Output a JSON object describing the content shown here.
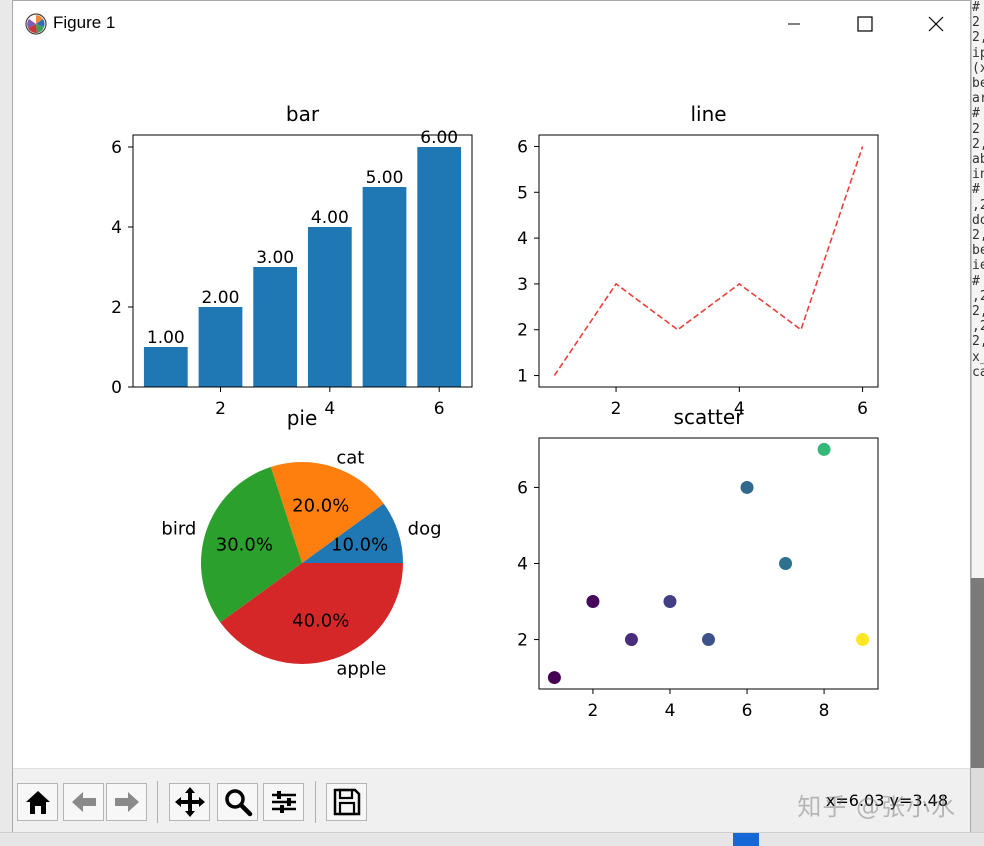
{
  "window": {
    "title": "Figure 1"
  },
  "toolbar": {
    "buttons": [
      "home-icon",
      "back-icon",
      "forward-icon",
      "pan-icon",
      "zoom-icon",
      "configure-icon",
      "save-icon"
    ],
    "coord_text": "x=6.03 y=3.48",
    "watermark": "知乎 @张小水"
  },
  "side_text": "#\n2\n2,\nip\n(x\nbe\nar\n#\n2\n2,\nab\nin\n#\n,2\ndo\n2,\nbe\nie\n#\n,2\n2,\n,2\n2,\nx_\nca",
  "chart_data": [
    {
      "type": "bar",
      "title": "bar",
      "categories": [
        1,
        2,
        3,
        4,
        5,
        6
      ],
      "values": [
        1,
        2,
        3,
        4,
        5,
        6
      ],
      "data_labels": [
        "1.00",
        "2.00",
        "3.00",
        "4.00",
        "5.00",
        "6.00"
      ],
      "xticks": [
        "2",
        "4",
        "6"
      ],
      "yticks": [
        "0",
        "2",
        "4",
        "6"
      ],
      "xlim": [
        0.4,
        6.6
      ],
      "ylim": [
        0,
        6.3
      ],
      "color": "#1f77b4"
    },
    {
      "type": "line",
      "title": "line",
      "x": [
        1,
        2,
        3,
        4,
        5,
        6
      ],
      "y": [
        1,
        3,
        2,
        3,
        2,
        6
      ],
      "style": "dashed",
      "color": "#e8413b",
      "xticks": [
        "2",
        "4",
        "6"
      ],
      "yticks": [
        "1",
        "2",
        "3",
        "4",
        "5",
        "6"
      ],
      "xlim": [
        0.75,
        6.25
      ],
      "ylim": [
        0.75,
        6.25
      ]
    },
    {
      "type": "pie",
      "title": "pie",
      "labels": [
        "dog",
        "cat",
        "bird",
        "apple"
      ],
      "values": [
        10,
        20,
        30,
        40
      ],
      "pct_labels": [
        "10.0%",
        "20.0%",
        "30.0%",
        "40.0%"
      ],
      "colors": [
        "#1f77b4",
        "#ff7f0e",
        "#2ca02c",
        "#d62728"
      ]
    },
    {
      "type": "scatter",
      "title": "scatter",
      "x": [
        1,
        2,
        3,
        4,
        5,
        6,
        7,
        8,
        9
      ],
      "y": [
        1,
        3,
        2,
        3,
        2,
        6,
        4,
        7,
        2
      ],
      "colors": [
        "#440154",
        "#46085c",
        "#472d7b",
        "#433e85",
        "#3b528b",
        "#31688e",
        "#2c728e",
        "#35b779",
        "#fde725"
      ],
      "xticks": [
        "2",
        "4",
        "6",
        "8"
      ],
      "yticks": [
        "2",
        "4",
        "6"
      ],
      "xlim": [
        0.6,
        9.4
      ],
      "ylim": [
        0.7,
        7.3
      ]
    }
  ]
}
